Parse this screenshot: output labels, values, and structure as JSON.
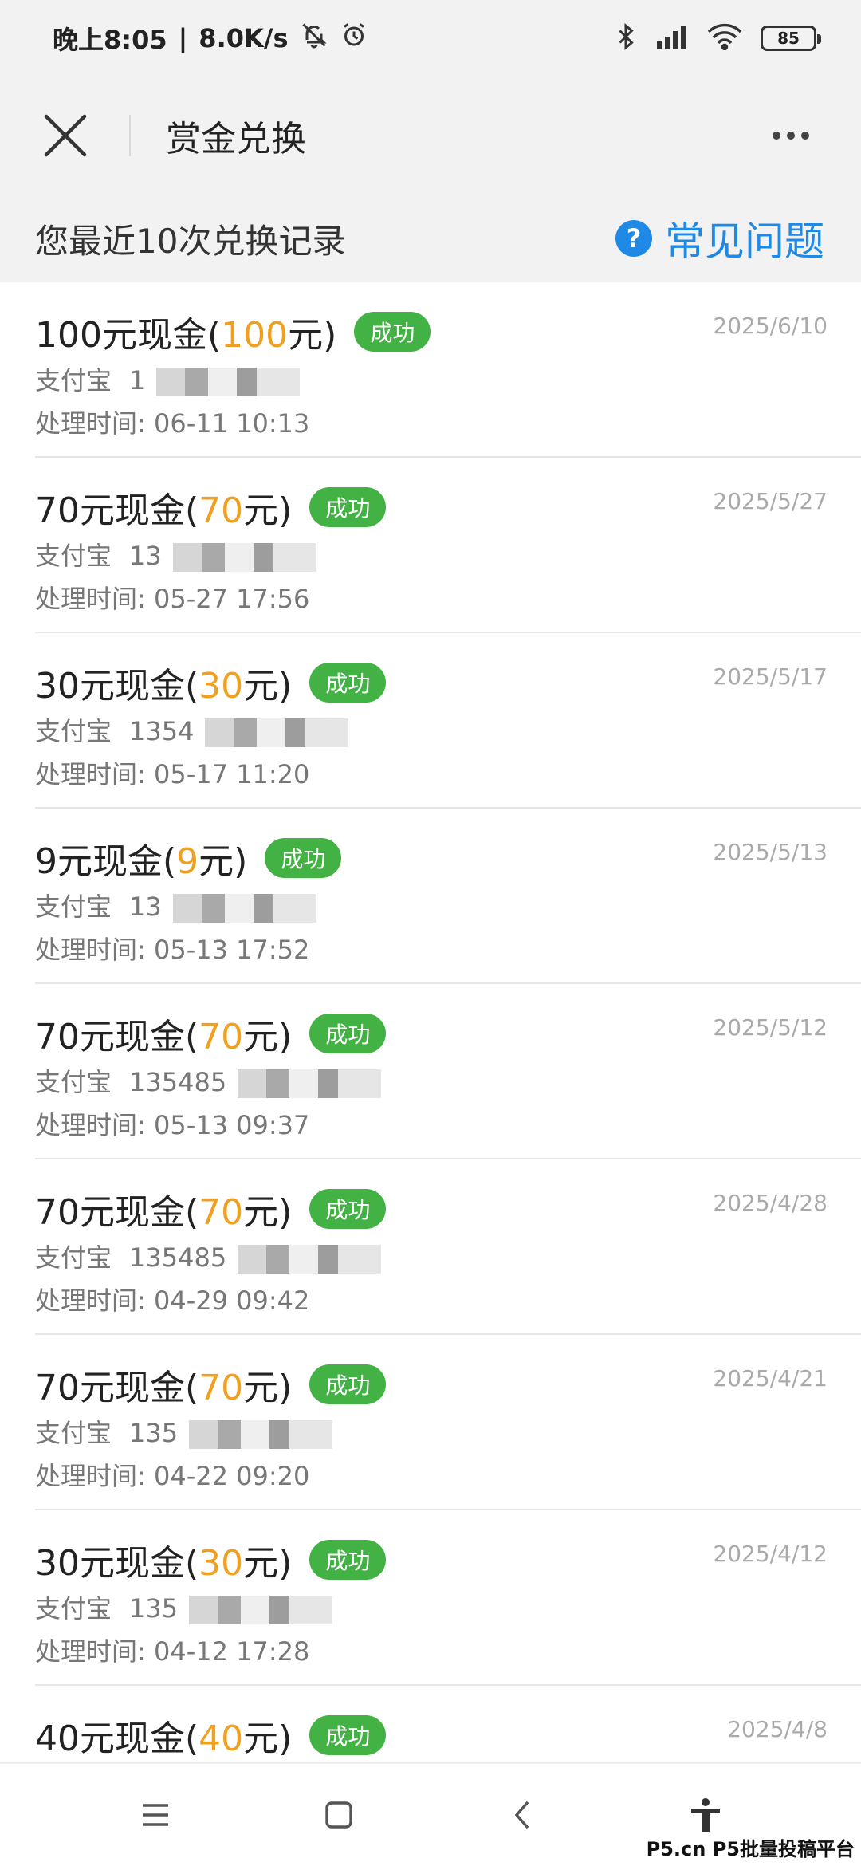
{
  "status_bar": {
    "time": "晚上8:05",
    "speed": "8.0K/s",
    "battery": "85",
    "icons": [
      "mute-bell-icon",
      "alarm-icon",
      "bluetooth-icon",
      "signal-icon",
      "wifi-icon",
      "battery-icon"
    ]
  },
  "title_bar": {
    "title": "赏金兑换",
    "close_icon": "close-icon",
    "more_icon": "more-icon"
  },
  "records_header": {
    "title": "您最近10次兑换记录",
    "faq_label": "常见问题",
    "faq_icon": "help-icon"
  },
  "records": [
    {
      "name_pre": "100元现金(",
      "amount": "100",
      "name_post": "元)",
      "status": "成功",
      "date": "2025/6/10",
      "account_label": "支付宝",
      "account": "1",
      "time_label": "处理时间:",
      "time": "06-11 10:13"
    },
    {
      "name_pre": "70元现金(",
      "amount": "70",
      "name_post": "元)",
      "status": "成功",
      "date": "2025/5/27",
      "account_label": "支付宝",
      "account": "13",
      "time_label": "处理时间:",
      "time": "05-27 17:56"
    },
    {
      "name_pre": "30元现金(",
      "amount": "30",
      "name_post": "元)",
      "status": "成功",
      "date": "2025/5/17",
      "account_label": "支付宝",
      "account": "1354",
      "time_label": "处理时间:",
      "time": "05-17 11:20"
    },
    {
      "name_pre": "9元现金(",
      "amount": "9",
      "name_post": "元)",
      "status": "成功",
      "date": "2025/5/13",
      "account_label": "支付宝",
      "account": "13",
      "time_label": "处理时间:",
      "time": "05-13 17:52"
    },
    {
      "name_pre": "70元现金(",
      "amount": "70",
      "name_post": "元)",
      "status": "成功",
      "date": "2025/5/12",
      "account_label": "支付宝",
      "account": "135485",
      "time_label": "处理时间:",
      "time": "05-13 09:37"
    },
    {
      "name_pre": "70元现金(",
      "amount": "70",
      "name_post": "元)",
      "status": "成功",
      "date": "2025/4/28",
      "account_label": "支付宝",
      "account": "135485",
      "time_label": "处理时间:",
      "time": "04-29 09:42"
    },
    {
      "name_pre": "70元现金(",
      "amount": "70",
      "name_post": "元)",
      "status": "成功",
      "date": "2025/4/21",
      "account_label": "支付宝",
      "account": "135",
      "time_label": "处理时间:",
      "time": "04-22 09:20"
    },
    {
      "name_pre": "30元现金(",
      "amount": "30",
      "name_post": "元)",
      "status": "成功",
      "date": "2025/4/12",
      "account_label": "支付宝",
      "account": "135",
      "time_label": "处理时间:",
      "time": "04-12 17:28"
    },
    {
      "name_pre": "40元现金(",
      "amount": "40",
      "name_post": "元)",
      "status": "成功",
      "date": "2025/4/8",
      "account_label": "",
      "account": "",
      "time_label": "",
      "time": ""
    }
  ],
  "nav_bar": {
    "icons": [
      "menu-icon",
      "home-icon",
      "back-icon",
      "accessibility-icon"
    ]
  },
  "watermark": "P5.cn P5批量投稿平台",
  "colors": {
    "accent_blue": "#1e8ae6",
    "success_green": "#43b244",
    "amount_orange": "#f0a020"
  }
}
